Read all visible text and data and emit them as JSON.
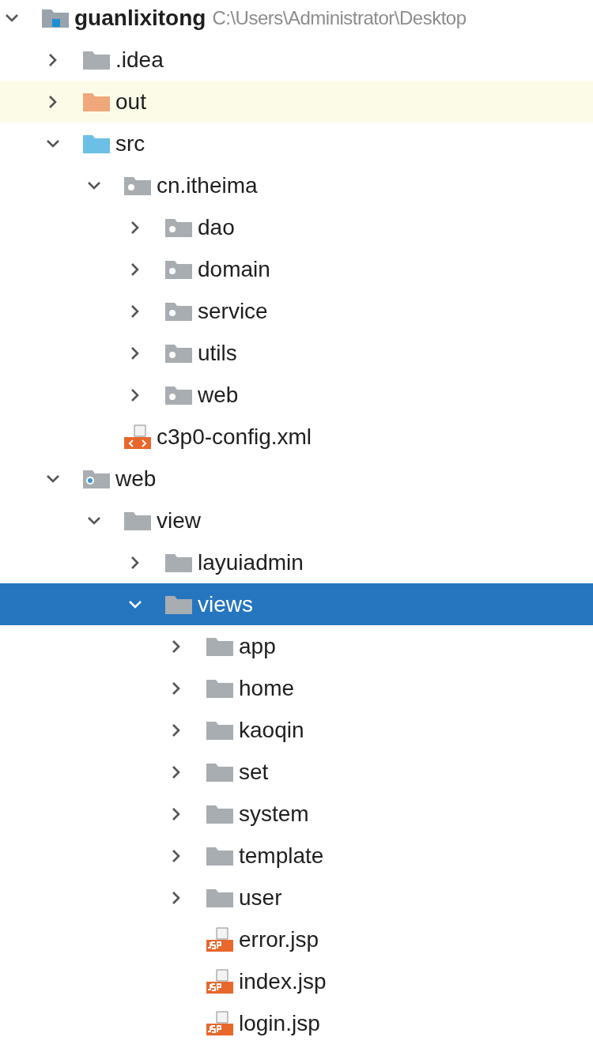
{
  "tree": [
    {
      "name": "guanlixitong",
      "path": "C:\\Users\\Administrator\\Desktop",
      "kind": "module",
      "expanded": true,
      "selected": false,
      "children": [
        {
          "name": ".idea",
          "kind": "folder",
          "expanded": false,
          "selected": false
        },
        {
          "name": "out",
          "kind": "excluded",
          "expanded": false,
          "selected": false,
          "highlighted": true
        },
        {
          "name": "src",
          "kind": "source",
          "expanded": true,
          "selected": false,
          "children": [
            {
              "name": "cn.itheima",
              "kind": "package",
              "expanded": true,
              "selected": false,
              "children": [
                {
                  "name": "dao",
                  "kind": "package",
                  "expanded": false,
                  "selected": false
                },
                {
                  "name": "domain",
                  "kind": "package",
                  "expanded": false,
                  "selected": false
                },
                {
                  "name": "service",
                  "kind": "package",
                  "expanded": false,
                  "selected": false
                },
                {
                  "name": "utils",
                  "kind": "package",
                  "expanded": false,
                  "selected": false
                },
                {
                  "name": "web",
                  "kind": "package",
                  "expanded": false,
                  "selected": false
                }
              ]
            },
            {
              "name": "c3p0-config.xml",
              "kind": "xml",
              "selected": false
            }
          ]
        },
        {
          "name": "web",
          "kind": "web",
          "expanded": true,
          "selected": false,
          "children": [
            {
              "name": "view",
              "kind": "folder",
              "expanded": true,
              "selected": false,
              "children": [
                {
                  "name": "layuiadmin",
                  "kind": "folder",
                  "expanded": false,
                  "selected": false
                },
                {
                  "name": "views",
                  "kind": "folder",
                  "expanded": true,
                  "selected": true,
                  "children": [
                    {
                      "name": "app",
                      "kind": "folder",
                      "expanded": false,
                      "selected": false
                    },
                    {
                      "name": "home",
                      "kind": "folder",
                      "expanded": false,
                      "selected": false
                    },
                    {
                      "name": "kaoqin",
                      "kind": "folder",
                      "expanded": false,
                      "selected": false
                    },
                    {
                      "name": "set",
                      "kind": "folder",
                      "expanded": false,
                      "selected": false
                    },
                    {
                      "name": "system",
                      "kind": "folder",
                      "expanded": false,
                      "selected": false
                    },
                    {
                      "name": "template",
                      "kind": "folder",
                      "expanded": false,
                      "selected": false
                    },
                    {
                      "name": "user",
                      "kind": "folder",
                      "expanded": false,
                      "selected": false
                    },
                    {
                      "name": "error.jsp",
                      "kind": "jsp",
                      "selected": false
                    },
                    {
                      "name": "index.jsp",
                      "kind": "jsp",
                      "selected": false
                    },
                    {
                      "name": "login.jsp",
                      "kind": "jsp",
                      "selected": false
                    }
                  ]
                }
              ]
            }
          ]
        }
      ]
    }
  ]
}
